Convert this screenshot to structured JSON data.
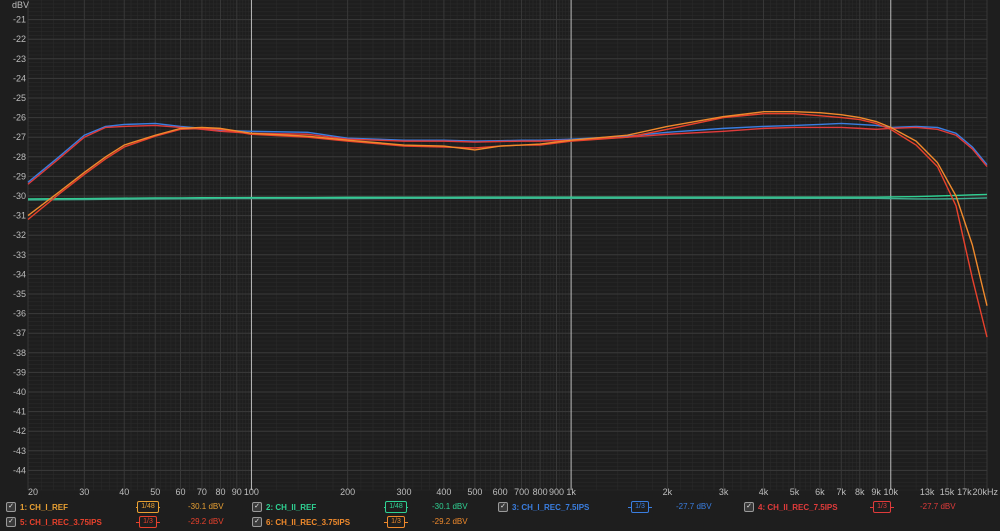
{
  "chart_data": {
    "type": "line",
    "ylabel": "dBV",
    "xscale": "log",
    "xlim": [
      20,
      20000
    ],
    "ylim": [
      -45,
      -20
    ],
    "grid": true,
    "x_ticks": [
      {
        "v": 20,
        "label": "20"
      },
      {
        "v": 30,
        "label": "30"
      },
      {
        "v": 40,
        "label": "40"
      },
      {
        "v": 50,
        "label": "50"
      },
      {
        "v": 60,
        "label": "60"
      },
      {
        "v": 70,
        "label": "70"
      },
      {
        "v": 80,
        "label": "80"
      },
      {
        "v": 90,
        "label": "90"
      },
      {
        "v": 100,
        "label": "100"
      },
      {
        "v": 200,
        "label": "200"
      },
      {
        "v": 300,
        "label": "300"
      },
      {
        "v": 400,
        "label": "400"
      },
      {
        "v": 500,
        "label": "500"
      },
      {
        "v": 600,
        "label": "600"
      },
      {
        "v": 700,
        "label": "700"
      },
      {
        "v": 800,
        "label": "800"
      },
      {
        "v": 900,
        "label": "900"
      },
      {
        "v": 1000,
        "label": "1k"
      },
      {
        "v": 2000,
        "label": "2k"
      },
      {
        "v": 3000,
        "label": "3k"
      },
      {
        "v": 4000,
        "label": "4k"
      },
      {
        "v": 5000,
        "label": "5k"
      },
      {
        "v": 6000,
        "label": "6k"
      },
      {
        "v": 7000,
        "label": "7k"
      },
      {
        "v": 8000,
        "label": "8k"
      },
      {
        "v": 9000,
        "label": "9k"
      },
      {
        "v": 10000,
        "label": "10k"
      },
      {
        "v": 13000,
        "label": "13k"
      },
      {
        "v": 15000,
        "label": "15k"
      },
      {
        "v": 17000,
        "label": "17k"
      },
      {
        "v": 20000,
        "label": "20kHz"
      }
    ],
    "y_ticks": [
      -21,
      -22,
      -23,
      -24,
      -25,
      -26,
      -27,
      -28,
      -29,
      -30,
      -31,
      -32,
      -33,
      -34,
      -35,
      -36,
      -37,
      -38,
      -39,
      -40,
      -41,
      -42,
      -43,
      -44
    ],
    "x": [
      20,
      25,
      30,
      35,
      40,
      50,
      60,
      70,
      80,
      100,
      150,
      200,
      300,
      400,
      500,
      600,
      700,
      800,
      1000,
      1500,
      2000,
      3000,
      4000,
      5000,
      6000,
      7000,
      8000,
      9000,
      10000,
      12000,
      14000,
      16000,
      18000,
      20000
    ],
    "series": [
      {
        "id": "s1",
        "name": "1: CH_I_REF",
        "color": "#2fd193",
        "values": [
          -30.15,
          -30.14,
          -30.13,
          -30.12,
          -30.11,
          -30.1,
          -30.1,
          -30.09,
          -30.09,
          -30.08,
          -30.08,
          -30.07,
          -30.07,
          -30.07,
          -30.06,
          -30.06,
          -30.06,
          -30.06,
          -30.06,
          -30.06,
          -30.06,
          -30.06,
          -30.06,
          -30.06,
          -30.06,
          -30.06,
          -30.06,
          -30.06,
          -30.05,
          -30.03,
          -30.0,
          -29.97,
          -29.94,
          -29.92
        ]
      },
      {
        "id": "s2",
        "name": "2: CH_II_REF",
        "color": "#3fae8f",
        "values": [
          -30.2,
          -30.19,
          -30.18,
          -30.17,
          -30.16,
          -30.15,
          -30.14,
          -30.14,
          -30.13,
          -30.13,
          -30.13,
          -30.13,
          -30.12,
          -30.12,
          -30.12,
          -30.12,
          -30.12,
          -30.12,
          -30.12,
          -30.12,
          -30.12,
          -30.12,
          -30.12,
          -30.12,
          -30.12,
          -30.12,
          -30.12,
          -30.12,
          -30.13,
          -30.15,
          -30.15,
          -30.14,
          -30.12,
          -30.1
        ]
      },
      {
        "id": "s3",
        "name": "3: CH_I_REC_7.5IPS",
        "color": "#3a7ee0",
        "values": [
          -29.3,
          -28.0,
          -26.9,
          -26.45,
          -26.35,
          -26.3,
          -26.45,
          -26.55,
          -26.65,
          -26.7,
          -26.75,
          -27.05,
          -27.15,
          -27.15,
          -27.2,
          -27.18,
          -27.15,
          -27.15,
          -27.1,
          -26.95,
          -26.75,
          -26.55,
          -26.45,
          -26.4,
          -26.35,
          -26.3,
          -26.35,
          -26.4,
          -26.5,
          -26.45,
          -26.5,
          -26.8,
          -27.5,
          -28.4
        ]
      },
      {
        "id": "s4",
        "name": "4: CH_II_REC_7.5IPS",
        "color": "#e03b3b",
        "values": [
          -29.4,
          -28.1,
          -27.0,
          -26.5,
          -26.45,
          -26.4,
          -26.5,
          -26.6,
          -26.7,
          -26.8,
          -26.85,
          -27.1,
          -27.2,
          -27.2,
          -27.25,
          -27.22,
          -27.2,
          -27.2,
          -27.15,
          -27.0,
          -26.85,
          -26.7,
          -26.55,
          -26.5,
          -26.5,
          -26.5,
          -26.55,
          -26.6,
          -26.55,
          -26.5,
          -26.6,
          -26.9,
          -27.6,
          -28.5
        ]
      },
      {
        "id": "s5",
        "name": "5: CH_I_REC_3.75IPS",
        "color": "#e8412c",
        "values": [
          -31.2,
          -29.9,
          -28.9,
          -28.1,
          -27.5,
          -26.95,
          -26.6,
          -26.55,
          -26.6,
          -26.85,
          -27.0,
          -27.2,
          -27.45,
          -27.5,
          -27.55,
          -27.45,
          -27.4,
          -27.4,
          -27.2,
          -27.0,
          -26.6,
          -26.0,
          -25.8,
          -25.8,
          -25.9,
          -26.0,
          -26.1,
          -26.3,
          -26.6,
          -27.4,
          -28.5,
          -30.5,
          -34.2,
          -37.2
        ]
      },
      {
        "id": "s6",
        "name": "6: CH_II_REC_3.75IPS",
        "color": "#f08a2c",
        "values": [
          -31.0,
          -29.8,
          -28.8,
          -28.0,
          -27.4,
          -26.9,
          -26.55,
          -26.5,
          -26.55,
          -26.8,
          -26.95,
          -27.15,
          -27.4,
          -27.45,
          -27.65,
          -27.45,
          -27.4,
          -27.35,
          -27.15,
          -26.9,
          -26.45,
          -25.95,
          -25.7,
          -25.7,
          -25.75,
          -25.85,
          -26.0,
          -26.2,
          -26.5,
          -27.2,
          -28.3,
          -30.0,
          -32.5,
          -35.6
        ]
      }
    ]
  },
  "legend": [
    {
      "name": "1: CH_I_REF",
      "smoothing": "1/48",
      "value": "-30.1 dBV",
      "color": "#e8a033",
      "box_color": "#e8a033",
      "value_color": "#e8a033"
    },
    {
      "name": "2: CH_II_REF",
      "smoothing": "1/48",
      "value": "-30.1 dBV",
      "color": "#2fd193",
      "box_color": "#2fd193",
      "value_color": "#2fd193"
    },
    {
      "name": "3: CH_I_REC_7.5IPS",
      "smoothing": "1/3",
      "value": "-27.7 dBV",
      "color": "#3a7ee0",
      "box_color": "#3a7ee0",
      "value_color": "#3a7ee0"
    },
    {
      "name": "4: CH_II_REC_7.5IPS",
      "smoothing": "1/3",
      "value": "-27.7 dBV",
      "color": "#e03b3b",
      "box_color": "#e03b3b",
      "value_color": "#e03b3b"
    },
    {
      "name": "5: CH_I_REC_3.75IPS",
      "smoothing": "1/3",
      "value": "-29.2 dBV",
      "color": "#e8412c",
      "box_color": "#e8412c",
      "value_color": "#e8412c"
    },
    {
      "name": "6: CH_II_REC_3.75IPS",
      "smoothing": "1/3",
      "value": "-29.2 dBV",
      "color": "#f08a2c",
      "box_color": "#f08a2c",
      "value_color": "#f08a2c"
    }
  ],
  "checkbox_mark": "✓",
  "colors": {
    "background": "#1e1e1e",
    "grid_major": "#3a3a3a",
    "grid_minor": "#2a2a2a",
    "grid_decade": "#bdbdbd"
  }
}
